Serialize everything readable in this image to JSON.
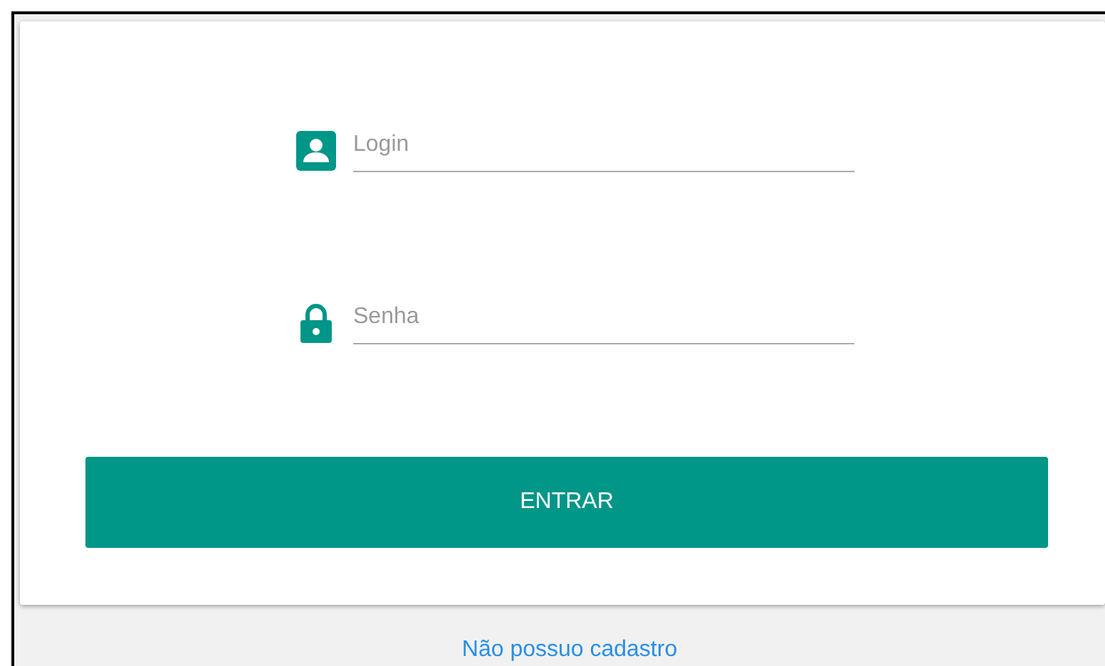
{
  "fields": [
    {
      "kind": "user",
      "placeholder": "Login"
    },
    {
      "kind": "lock",
      "placeholder": "Senha"
    }
  ],
  "submit_button": "ENTRAR",
  "register_link": "Não possuo cadastro"
}
